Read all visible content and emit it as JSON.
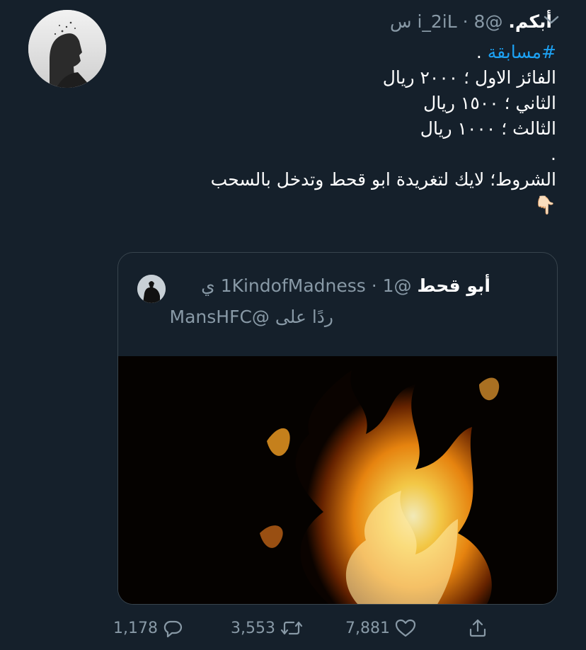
{
  "tweet": {
    "name": "أبكم.",
    "handle": "@i_2iL",
    "separator": "·",
    "time": "8 س",
    "body": {
      "hashtag": "#مسابقة",
      "hashtag_suffix": " .",
      "line1": "الفائز الاول ؛ ٢٠٠٠ ريال",
      "line2": "الثاني ؛ ١٥٠٠ ريال",
      "line3": "الثالث ؛ ١٠٠٠ ريال",
      "line4": ".",
      "line5": "الشروط؛ لايك لتغريدة ابو قحط وتدخل بالسحب",
      "emoji": "👇🏻"
    },
    "quote": {
      "name": "أبو قحط",
      "handle": "@1KindofMadness",
      "separator": "·",
      "time": "1 ي",
      "reply_to": "ردًا على @MansHFC"
    },
    "actions": {
      "replies": "1,178",
      "retweets": "3,553",
      "likes": "7,881"
    }
  }
}
